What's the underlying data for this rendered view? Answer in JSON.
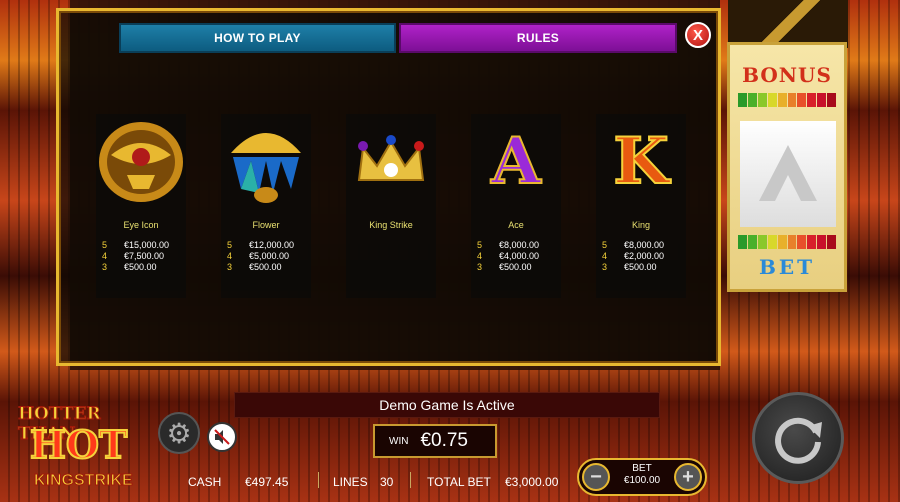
{
  "tabs": {
    "how_to_play": "HOW TO PLAY",
    "rules": "RULES",
    "close": "X"
  },
  "paytable": [
    {
      "name": "Eye Icon",
      "icon": "eye-of-horus-icon",
      "pays": [
        [
          "5",
          "€15,000.00"
        ],
        [
          "4",
          "€7,500.00"
        ],
        [
          "3",
          "€500.00"
        ]
      ]
    },
    {
      "name": "Flower",
      "icon": "lotus-flower-icon",
      "pays": [
        [
          "5",
          "€12,000.00"
        ],
        [
          "4",
          "€5,000.00"
        ],
        [
          "3",
          "€500.00"
        ]
      ]
    },
    {
      "name": "King Strike",
      "icon": "crown-icon",
      "pays": []
    },
    {
      "name": "Ace",
      "icon": "ace-card-icon",
      "symbol": "A",
      "pays": [
        [
          "5",
          "€8,000.00"
        ],
        [
          "4",
          "€4,000.00"
        ],
        [
          "3",
          "€500.00"
        ]
      ]
    },
    {
      "name": "King",
      "icon": "king-card-icon",
      "symbol": "K",
      "pays": [
        [
          "5",
          "€8,000.00"
        ],
        [
          "4",
          "€2,000.00"
        ],
        [
          "3",
          "€500.00"
        ]
      ]
    }
  ],
  "side": {
    "bonus_label": "BONUS",
    "bet_label": "BET"
  },
  "status": {
    "demo": "Demo Game Is Active",
    "win_label": "WIN",
    "win_value": "€0.75",
    "cash_label": "CASH",
    "cash_value": "€497.45",
    "lines_label": "LINES",
    "lines_value": "30",
    "total_bet_label": "TOTAL BET",
    "total_bet_value": "€3,000.00",
    "bet_label": "BET",
    "bet_value": "€100.00"
  },
  "logo": {
    "line1": "HOTTER THAN",
    "line2": "HOT",
    "line3": "KINGSTRIKE"
  },
  "colors": {
    "tab_how": "#1e7fa8",
    "tab_rules": "#b022c8",
    "frame_gold": "#e8b830",
    "win_text": "#ffffff"
  }
}
